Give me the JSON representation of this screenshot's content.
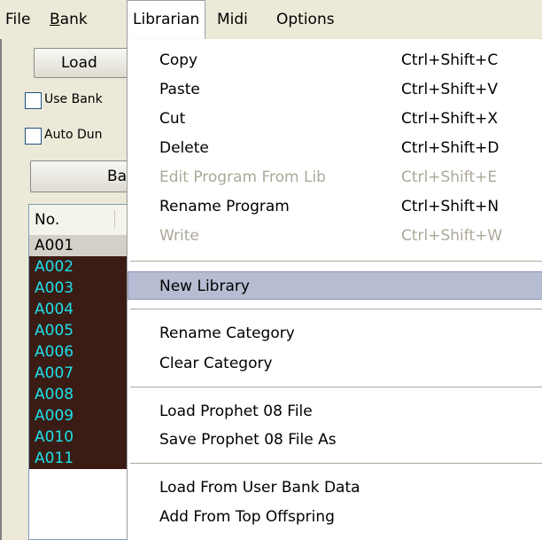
{
  "menubar": {
    "file": "File",
    "bank": "Bank",
    "librarian": "Librarian",
    "midi": "Midi",
    "options": "Options"
  },
  "left": {
    "load_button": "Load",
    "use_bank": "Use Bank",
    "auto_dump": "Auto Dun",
    "bank_button": "Ba",
    "list_header": "No.",
    "rows": [
      "A001",
      "A002",
      "A003",
      "A004",
      "A005",
      "A006",
      "A007",
      "A008",
      "A009",
      "A010",
      "A011"
    ]
  },
  "librarian_menu": {
    "copy": {
      "label": "Copy",
      "shortcut": "Ctrl+Shift+C"
    },
    "paste": {
      "label": "Paste",
      "shortcut": "Ctrl+Shift+V"
    },
    "cut": {
      "label": "Cut",
      "shortcut": "Ctrl+Shift+X"
    },
    "delete": {
      "label": "Delete",
      "shortcut": "Ctrl+Shift+D"
    },
    "edit_program": {
      "label": "Edit Program From Lib",
      "shortcut": "Ctrl+Shift+E"
    },
    "rename_program": {
      "label": "Rename Program",
      "shortcut": "Ctrl+Shift+N"
    },
    "write": {
      "label": "Write",
      "shortcut": "Ctrl+Shift+W"
    },
    "new_library": {
      "label": "New Library"
    },
    "rename_category": {
      "label": "Rename Category"
    },
    "clear_category": {
      "label": "Clear Category"
    },
    "load_file": {
      "label": "Load Prophet 08 File"
    },
    "save_file": {
      "label": "Save Prophet 08 File As"
    },
    "load_user_bank": {
      "label": "Load From User Bank Data"
    },
    "add_offspring": {
      "label": "Add From Top Offspring"
    }
  },
  "colors": {
    "list_bg": "#3a1c14",
    "list_text": "#1fe0ea",
    "hover": "#b6bdd2",
    "disabled": "#aca899"
  }
}
